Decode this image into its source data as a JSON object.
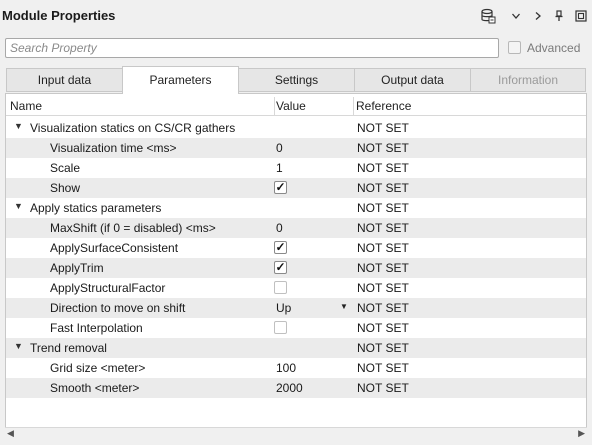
{
  "window": {
    "title": "Module Properties"
  },
  "toolbar": {
    "icons": [
      "database-icon",
      "chevron-down-icon",
      "chevron-right-icon",
      "pin-icon",
      "restore-window-icon"
    ]
  },
  "search": {
    "placeholder": "Search Property",
    "value": ""
  },
  "advanced": {
    "label": "Advanced",
    "checked": false,
    "enabled": false
  },
  "tabs": [
    {
      "label": "Input data",
      "active": false,
      "enabled": true
    },
    {
      "label": "Parameters",
      "active": true,
      "enabled": true
    },
    {
      "label": "Settings",
      "active": false,
      "enabled": true
    },
    {
      "label": "Output data",
      "active": false,
      "enabled": true
    },
    {
      "label": "Information",
      "active": false,
      "enabled": false
    }
  ],
  "grid": {
    "columns": [
      "Name",
      "Value",
      "Reference"
    ],
    "rows": [
      {
        "name": "Visualization statics on CS/CR gathers",
        "group": true,
        "value": "",
        "reference": "NOT SET"
      },
      {
        "name": "Visualization time <ms>",
        "group": false,
        "value": "0",
        "reference": "NOT SET"
      },
      {
        "name": "Scale",
        "group": false,
        "value": "1",
        "reference": "NOT SET"
      },
      {
        "name": "Show",
        "group": false,
        "checkbox": true,
        "checked": true,
        "reference": "NOT SET"
      },
      {
        "name": "Apply statics parameters",
        "group": true,
        "value": "",
        "reference": "NOT SET"
      },
      {
        "name": "MaxShift (if 0 = disabled) <ms>",
        "group": false,
        "value": "0",
        "reference": "NOT SET"
      },
      {
        "name": "ApplySurfaceConsistent",
        "group": false,
        "checkbox": true,
        "checked": true,
        "reference": "NOT SET"
      },
      {
        "name": "ApplyTrim",
        "group": false,
        "checkbox": true,
        "checked": true,
        "reference": "NOT SET"
      },
      {
        "name": "ApplyStructuralFactor",
        "group": false,
        "checkbox": true,
        "checked": false,
        "reference": "NOT SET"
      },
      {
        "name": "Direction to move on shift",
        "group": false,
        "dropdown": true,
        "value": "Up",
        "reference": "NOT SET"
      },
      {
        "name": "Fast Interpolation",
        "group": false,
        "checkbox": true,
        "checked": false,
        "reference": "NOT SET"
      },
      {
        "name": "Trend removal",
        "group": true,
        "value": "",
        "reference": "NOT SET"
      },
      {
        "name": "Grid size <meter>",
        "group": false,
        "value": "100",
        "reference": "NOT SET"
      },
      {
        "name": "Smooth <meter>",
        "group": false,
        "value": "2000",
        "reference": "NOT SET"
      }
    ]
  }
}
